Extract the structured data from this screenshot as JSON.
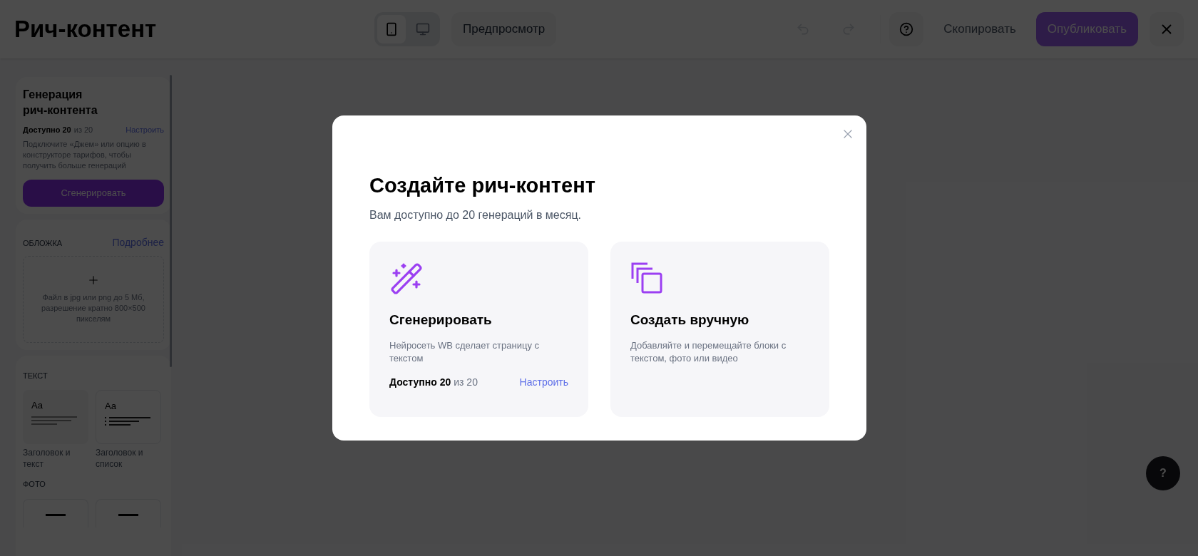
{
  "header": {
    "title": "Рич-контент",
    "devices": [
      {
        "kind": "mobile",
        "selected": true
      },
      {
        "kind": "desktop",
        "selected": false
      }
    ],
    "preview": "Предпросмотр",
    "undo": {
      "disabled": true
    },
    "redo": {
      "disabled": true
    },
    "copy": {
      "label": "Скопировать",
      "disabled": true
    },
    "publish": {
      "label": "Опубликовать",
      "disabled": true
    }
  },
  "sidebar": {
    "generation": {
      "title": "Генерация рич-контента",
      "available": "Доступно 20",
      "total": "из 20",
      "link": "Настроить",
      "note": "Подключите «Джем» или опцию в конструкторе тарифов, чтобы получить больше генераций",
      "button": "Сгенерировать"
    },
    "cover": {
      "heading": "ОБЛОЖКА",
      "link": "Подробнее",
      "hint": "Файл в jpg или png до 5 Мб, разрешение кратно 800×500 пикселям"
    },
    "sections": [
      {
        "heading": "ТЕКСТ",
        "templates": [
          {
            "kind": "text",
            "sample": "Aa",
            "label": "Заголовок и текст"
          },
          {
            "kind": "list",
            "sample": "Aa",
            "label": "Заголовок и список"
          }
        ]
      },
      {
        "heading": "ФОТО",
        "templates": [
          {
            "kind": "photo"
          },
          {
            "kind": "photo"
          }
        ]
      }
    ]
  },
  "modal": {
    "title": "Создайте рич-контент",
    "subtitle": "Вам доступно до 20 генераций в месяц.",
    "options": [
      {
        "kind": "generate",
        "title": "Сгенерировать",
        "description": "Нейросеть WB сделает страницу с текстом",
        "available": "Доступно 20",
        "total": "из 20",
        "link": "Настроить"
      },
      {
        "kind": "manual",
        "title": "Создать вручную",
        "description": "Добавляйте и перемещайте блоки с текстом, фото или видео"
      }
    ]
  },
  "help": "?"
}
